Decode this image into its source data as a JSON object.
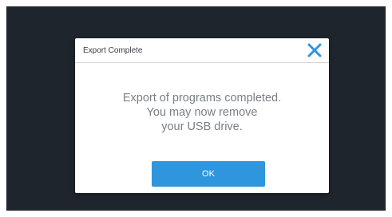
{
  "dialog": {
    "title": "Export Complete",
    "close_icon": "close-icon",
    "message_lines": [
      "Export of programs completed.",
      "You may now remove",
      "your USB drive."
    ],
    "ok_label": "OK"
  },
  "colors": {
    "background": "#1f252c",
    "accent": "#2f95dc",
    "dialog": "#ffffff",
    "message_text": "#7a7f84"
  }
}
